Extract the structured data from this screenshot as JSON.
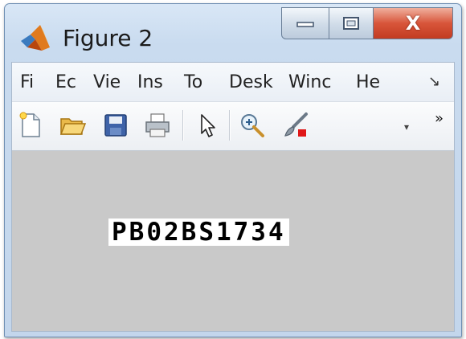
{
  "window": {
    "title": "Figure 2",
    "controls": {
      "minimize": "minimize-icon",
      "maximize": "maximize-icon",
      "close_label": "X"
    }
  },
  "menubar": {
    "items": [
      "Fi",
      "Ec",
      "Vie",
      "Ins",
      "To",
      "Desk",
      "Winc",
      "He"
    ],
    "more": "↘"
  },
  "toolbar": {
    "buttons": [
      "new-file-icon",
      "open-folder-icon",
      "save-icon",
      "print-icon",
      "pointer-arrow-icon",
      "zoom-in-icon",
      "brush-icon"
    ],
    "dropdown": "▾",
    "more": "»"
  },
  "figure": {
    "plate_text": "PB02BS1734"
  },
  "colors": {
    "canvas_bg": "#c9c9c9",
    "close_button": "#c8462b",
    "title_bar": "#c3d6ec"
  }
}
